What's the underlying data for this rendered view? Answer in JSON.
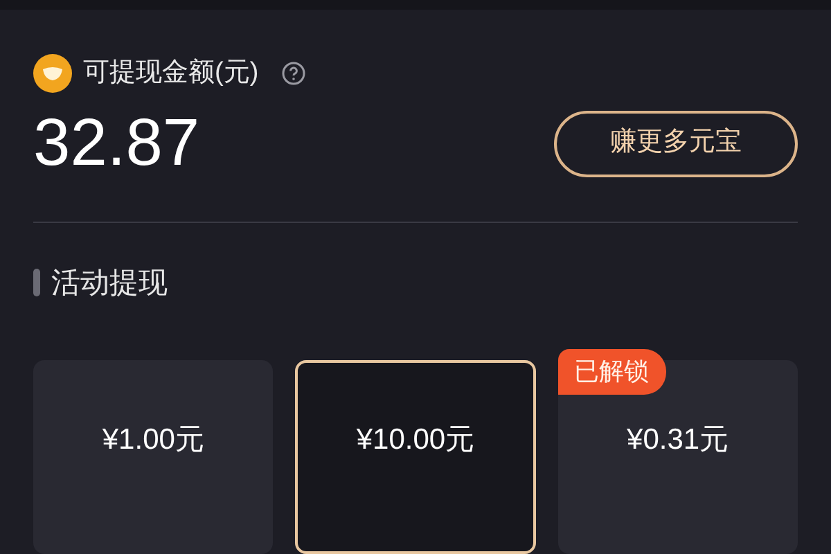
{
  "balance": {
    "label": "可提现金额(元)",
    "amount": "32.87",
    "action": "赚更多元宝"
  },
  "section": {
    "title": "活动提现"
  },
  "options": [
    {
      "amount": "¥1.00元",
      "selected": false
    },
    {
      "amount": "¥10.00元",
      "selected": true
    },
    {
      "amount": "¥0.31元",
      "selected": false,
      "badge": "已解锁"
    }
  ]
}
